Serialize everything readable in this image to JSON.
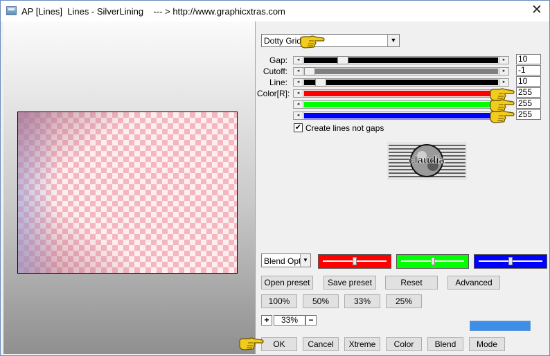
{
  "window": {
    "title": "AP [Lines]  Lines - SilverLining    --- > http://www.graphicxtras.com",
    "close_glyph": "✕"
  },
  "preset_select": {
    "value": "Dotty Grid",
    "arrow": "▼"
  },
  "sliders": [
    {
      "label": "Gap:",
      "value": "10",
      "level": 0.18,
      "fill_color": "#000000"
    },
    {
      "label": "Cutoff:",
      "value": "-1",
      "level": 0.0,
      "fill_color": "#808080"
    },
    {
      "label": "Line:",
      "value": "10",
      "level": 0.06,
      "fill_color": "#000000"
    },
    {
      "label": "Color[R]:",
      "value": "255",
      "level": 1.0,
      "fill_color": "#ff0000"
    },
    {
      "label": "",
      "value": "255",
      "level": 1.0,
      "fill_color": "#00ff00"
    },
    {
      "label": "",
      "value": "255",
      "level": 1.0,
      "fill_color": "#0000ff"
    }
  ],
  "arrows": {
    "left": "◂",
    "right": "▸"
  },
  "checkbox": {
    "checked_glyph": "✔",
    "label": "Create lines not gaps"
  },
  "logo": {
    "text": "claudia"
  },
  "blend_options": {
    "value": "Blend Options",
    "arrow": "▼"
  },
  "color_swatches": [
    {
      "color": "#ff0000",
      "level": 0.5
    },
    {
      "color": "#00ff00",
      "level": 0.5
    },
    {
      "color": "#0000ff",
      "level": 0.5
    }
  ],
  "buttons_row1": [
    "Open preset",
    "Save preset",
    "Reset",
    "Advanced"
  ],
  "zoom_buttons": [
    "100%",
    "50%",
    "33%",
    "25%"
  ],
  "zoom": {
    "plus": "+",
    "value": "33%",
    "minus": "−"
  },
  "bottom_buttons": [
    "OK",
    "Cancel",
    "Xtreme",
    "Color",
    "Blend",
    "Mode"
  ],
  "colors": {
    "accent_bar": "#3d8ee8",
    "pointer_hand": "#f2cc1c"
  },
  "icons": {
    "pointer": "pointing-hand-icon",
    "app": "app-icon",
    "close": "close-icon"
  }
}
